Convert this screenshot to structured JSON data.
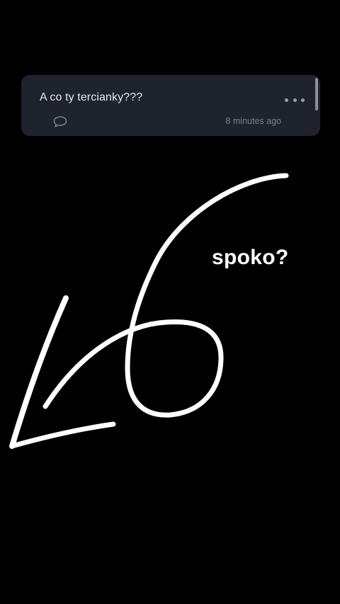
{
  "question_card": {
    "text": "A co ty tercianky???",
    "timestamp": "8 minutes ago",
    "more_icon": "ellipsis-icon",
    "comment_icon": "comment-bubble-icon"
  },
  "overlay": {
    "text": "spoko?"
  },
  "colors": {
    "background": "#000000",
    "card": "#1f232c",
    "drawing_stroke": "#ffffff"
  }
}
